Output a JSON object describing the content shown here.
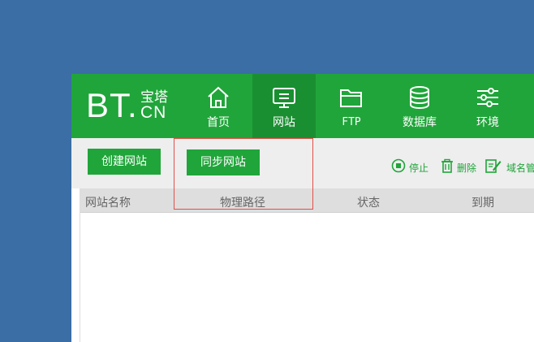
{
  "logo": {
    "main": "BT.",
    "sub_top": "宝塔",
    "sub_bottom": "CN"
  },
  "nav": [
    {
      "label": "首页",
      "icon": "home-icon"
    },
    {
      "label": "网站",
      "icon": "monitor-icon",
      "active": true
    },
    {
      "label": "FTP",
      "icon": "folder-icon"
    },
    {
      "label": "数据库",
      "icon": "database-icon"
    },
    {
      "label": "环境",
      "icon": "sliders-icon"
    }
  ],
  "toolbar": {
    "create_site": "创建网站",
    "sync_site": "同步网站",
    "actions": {
      "stop": "停止",
      "delete": "删除",
      "domain": "域名管"
    }
  },
  "table": {
    "headers": [
      "网站名称",
      "物理路径",
      "状态",
      "到期"
    ]
  },
  "colors": {
    "desktop": "#3a6ea5",
    "brand_green": "#20a53a",
    "active_nav": "#1a8f31",
    "highlight": "#e0504a"
  }
}
